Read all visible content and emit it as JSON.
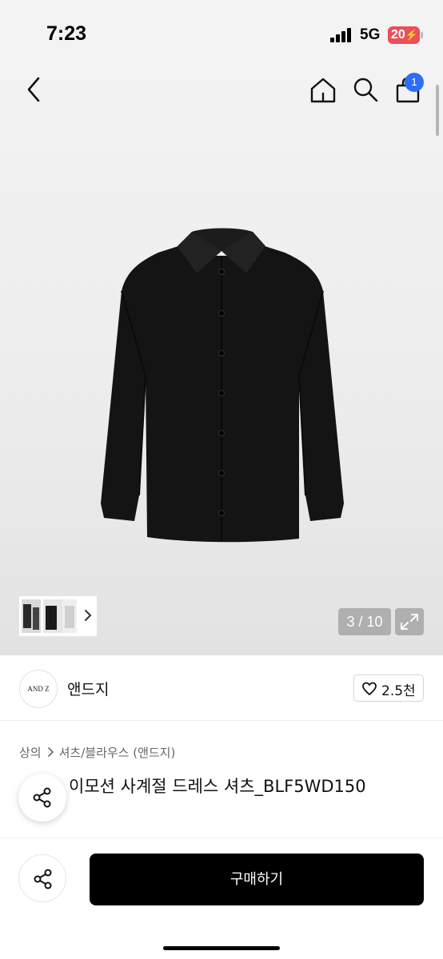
{
  "status_bar": {
    "time": "7:23",
    "network": "5G",
    "battery": "20"
  },
  "header": {
    "cart_count": "1"
  },
  "gallery": {
    "page_counter": "3 / 10"
  },
  "brand": {
    "logo_text": "AND Z",
    "name": "앤드지",
    "likes": "2.5천"
  },
  "breadcrumb": {
    "category": "상의",
    "subcategory": "셔츠/블라우스 (앤드지)"
  },
  "product": {
    "title": "이모션 사계절 드레스 셔츠_BLF5WD150"
  },
  "actions": {
    "buy_label": "구매하기"
  },
  "colors": {
    "accent": "#2f6df6",
    "buy_button": "#000000",
    "battery": "#e8505a"
  }
}
